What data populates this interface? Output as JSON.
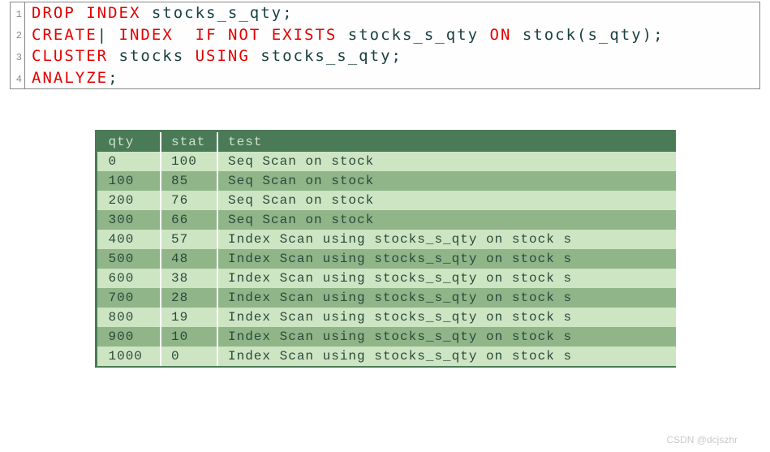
{
  "code": {
    "lines": [
      {
        "num": "1",
        "tokens": [
          {
            "t": "DROP INDEX",
            "c": "kw-red"
          },
          {
            "t": " stocks_s_qty;",
            "c": "kw-black"
          }
        ]
      },
      {
        "num": "2",
        "tokens": [
          {
            "t": "CREATE",
            "c": "kw-red"
          },
          {
            "t": "| ",
            "c": "kw-black"
          },
          {
            "t": "INDEX ",
            "c": "kw-red"
          },
          {
            "t": " ",
            "c": "kw-black"
          },
          {
            "t": "IF NOT EXISTS",
            "c": "kw-red"
          },
          {
            "t": " stocks_s_qty ",
            "c": "kw-black"
          },
          {
            "t": "ON",
            "c": "kw-red"
          },
          {
            "t": " stock(s_qty);",
            "c": "kw-black"
          }
        ]
      },
      {
        "num": "3",
        "tokens": [
          {
            "t": "CLUSTER",
            "c": "kw-red"
          },
          {
            "t": " stocks ",
            "c": "kw-black"
          },
          {
            "t": "USING",
            "c": "kw-red"
          },
          {
            "t": " stocks_s_qty;",
            "c": "kw-black"
          }
        ]
      },
      {
        "num": "4",
        "tokens": [
          {
            "t": "ANALYZE",
            "c": "kw-red"
          },
          {
            "t": ";",
            "c": "kw-black"
          }
        ]
      }
    ]
  },
  "table": {
    "headers": [
      "qty",
      "stat",
      "test"
    ],
    "rows": [
      {
        "qty": "0",
        "stat": "100",
        "test": "Seq Scan on stock"
      },
      {
        "qty": "100",
        "stat": "85",
        "test": "Seq Scan on stock"
      },
      {
        "qty": "200",
        "stat": "76",
        "test": "Seq Scan on stock"
      },
      {
        "qty": "300",
        "stat": "66",
        "test": "Seq Scan on stock"
      },
      {
        "qty": "400",
        "stat": "57",
        "test": "Index Scan using stocks_s_qty on stock s"
      },
      {
        "qty": "500",
        "stat": "48",
        "test": "Index Scan using stocks_s_qty on stock s"
      },
      {
        "qty": "600",
        "stat": "38",
        "test": "Index Scan using stocks_s_qty on stock s"
      },
      {
        "qty": "700",
        "stat": "28",
        "test": "Index Scan using stocks_s_qty on stock s"
      },
      {
        "qty": "800",
        "stat": "19",
        "test": "Index Scan using stocks_s_qty on stock s"
      },
      {
        "qty": "900",
        "stat": "10",
        "test": "Index Scan using stocks_s_qty on stock s"
      },
      {
        "qty": "1000",
        "stat": "0",
        "test": "Index Scan using stocks_s_qty on stock s"
      }
    ]
  },
  "chart_data": {
    "type": "table",
    "title": "",
    "columns": [
      "qty",
      "stat",
      "test"
    ],
    "data": [
      [
        0,
        100,
        "Seq Scan on stock"
      ],
      [
        100,
        85,
        "Seq Scan on stock"
      ],
      [
        200,
        76,
        "Seq Scan on stock"
      ],
      [
        300,
        66,
        "Seq Scan on stock"
      ],
      [
        400,
        57,
        "Index Scan using stocks_s_qty on stock s"
      ],
      [
        500,
        48,
        "Index Scan using stocks_s_qty on stock s"
      ],
      [
        600,
        38,
        "Index Scan using stocks_s_qty on stock s"
      ],
      [
        700,
        28,
        "Index Scan using stocks_s_qty on stock s"
      ],
      [
        800,
        19,
        "Index Scan using stocks_s_qty on stock s"
      ],
      [
        900,
        10,
        "Index Scan using stocks_s_qty on stock s"
      ],
      [
        1000,
        0,
        "Index Scan using stocks_s_qty on stock s"
      ]
    ]
  },
  "watermark": "CSDN @dcjszhr"
}
